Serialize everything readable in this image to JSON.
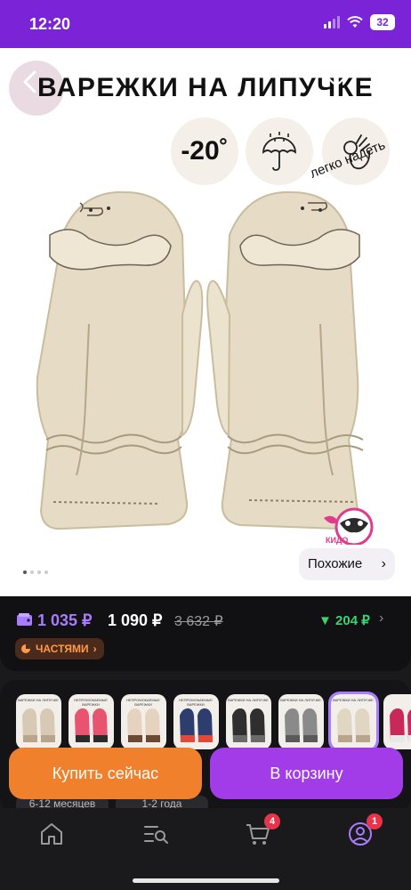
{
  "status_bar": {
    "time": "12:20",
    "battery": "32"
  },
  "product": {
    "title": "ВАРЕЖКИ НА ЛИПУЧКЕ",
    "temperature": "-20˚",
    "easy_label": "легко надеть",
    "brand": "КИДО",
    "carousel": {
      "total": 4,
      "active": 1
    },
    "similar_label": "Похожие"
  },
  "pricing": {
    "wallet_price": "1 035 ₽",
    "price": "1 090 ₽",
    "old_price": "3 632 ₽",
    "bonus": "204 ₽",
    "installments_label": "ЧАСТЯМИ"
  },
  "variants": {
    "thumbnails": [
      {
        "label": "ВАРЕЖКИ НА ЛИПУЧКЕ",
        "color": "#d8c9b4",
        "accent": "#b9a58c"
      },
      {
        "label": "НЕПРОМОКАЕМЫЕ ВАРЕЖКИ",
        "color": "#e8536f",
        "accent": "#2c2c2c"
      },
      {
        "label": "НЕПРОМОКАЕМЫЕ ВАРЕЖКИ",
        "color": "#e6d3bf",
        "accent": "#6b4a33"
      },
      {
        "label": "НЕПРОМОКАЕМЫЕ ВАРЕЖКИ",
        "color": "#2d3e6e",
        "accent": "#e04a3a"
      },
      {
        "label": "ВАРЕЖКИ НА ЛИПУЧКЕ",
        "color": "#2f2f2f",
        "accent": "#6a6a6a"
      },
      {
        "label": "ВАРЕЖКИ НА ЛИПУЧКЕ",
        "color": "#8a8a8a",
        "accent": "#5a5a5a"
      },
      {
        "label": "ВАРЕЖКИ НА ЛИПУЧКЕ",
        "color": "#e0d6c2",
        "accent": "#b9a58c"
      },
      {
        "label": "",
        "color": "#c8285a",
        "accent": "#e8e8e8"
      }
    ],
    "sizes": [
      "6-12 месяцев",
      "1-2 года"
    ]
  },
  "actions": {
    "buy_now": "Купить сейчас",
    "add_to_cart": "В корзину"
  },
  "tabbar": {
    "cart_count": "4",
    "profile_count": "1"
  },
  "colors": {
    "brand_purple": "#7b23d6",
    "buy_orange": "#f0802c",
    "cart_purple": "#a13ce8",
    "bonus_green": "#3ed26f"
  }
}
